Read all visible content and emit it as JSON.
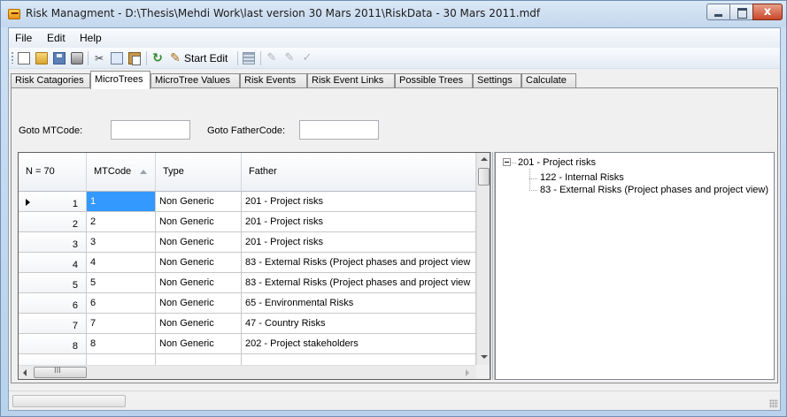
{
  "window": {
    "title": "Risk Managment - D:\\Thesis\\Mehdi Work\\last version 30 Mars 2011\\RiskData - 30 Mars 2011.mdf",
    "close_glyph": "x"
  },
  "menu": {
    "items": [
      "File",
      "Edit",
      "Help"
    ]
  },
  "toolbar": {
    "start_edit_label": "Start Edit",
    "icons": [
      "new-icon",
      "open-icon",
      "save-icon",
      "print-icon",
      "cut-icon",
      "copy-icon",
      "paste-icon",
      "refresh-icon",
      "pencil-icon",
      "grid-icon",
      "edit-disabled-icon",
      "edit-disabled-icon",
      "check-disabled-icon"
    ]
  },
  "tabs": [
    {
      "label": "Risk Catagories",
      "active": false
    },
    {
      "label": "MicroTrees",
      "active": true
    },
    {
      "label": "MicroTree Values",
      "active": false
    },
    {
      "label": "Risk Events",
      "active": false
    },
    {
      "label": "Risk Event Links",
      "active": false
    },
    {
      "label": "Possible Trees",
      "active": false
    },
    {
      "label": "Settings",
      "active": false
    },
    {
      "label": "Calculate",
      "active": false
    }
  ],
  "filters": {
    "goto_mtcode_label": "Goto MTCode:",
    "goto_mtcode_value": "",
    "goto_father_label": "Goto FatherCode:",
    "goto_father_value": ""
  },
  "grid": {
    "row_count_label": "N = 70",
    "columns": [
      "MTCode",
      "Type",
      "Father"
    ],
    "sorted_column": "MTCode",
    "rows": [
      {
        "n": "1",
        "mtcode": "1",
        "type": "Non Generic",
        "father": "201 - Project risks",
        "selected": true
      },
      {
        "n": "2",
        "mtcode": "2",
        "type": "Non Generic",
        "father": "201 - Project risks"
      },
      {
        "n": "3",
        "mtcode": "3",
        "type": "Non Generic",
        "father": "201 - Project risks"
      },
      {
        "n": "4",
        "mtcode": "4",
        "type": "Non Generic",
        "father": "83 - External Risks (Project phases and  project view"
      },
      {
        "n": "5",
        "mtcode": "5",
        "type": "Non Generic",
        "father": "83 - External Risks (Project phases and  project view"
      },
      {
        "n": "6",
        "mtcode": "6",
        "type": "Non Generic",
        "father": "65 - Environmental Risks"
      },
      {
        "n": "7",
        "mtcode": "7",
        "type": "Non Generic",
        "father": "47 - Country Risks"
      },
      {
        "n": "8",
        "mtcode": "8",
        "type": "Non Generic",
        "father": "202 - Project stakeholders"
      }
    ],
    "hscroll_glyph": "III"
  },
  "tree": {
    "root": "201 - Project risks",
    "children": [
      "122 - Internal Risks",
      "83 - External Risks (Project phases and  project view)"
    ]
  }
}
